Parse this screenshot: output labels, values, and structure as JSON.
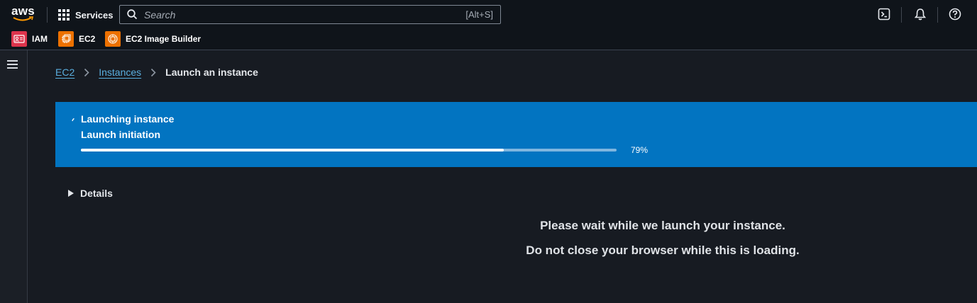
{
  "header": {
    "logo_text": "aws",
    "services_label": "Services",
    "search": {
      "placeholder": "Search",
      "shortcut": "[Alt+S]"
    },
    "tools": [
      "cloudshell-icon",
      "notifications-icon",
      "help-icon"
    ]
  },
  "favorites": [
    {
      "label": "IAM",
      "color": "#dd344c"
    },
    {
      "label": "EC2",
      "color": "#ed7100"
    },
    {
      "label": "EC2 Image Builder",
      "color": "#ed7100"
    }
  ],
  "breadcrumb": {
    "items": [
      "EC2",
      "Instances"
    ],
    "current": "Launch an instance"
  },
  "flash": {
    "title": "Launching instance",
    "subtitle": "Launch initiation",
    "progress_value": 0.79,
    "progress_label": "79%",
    "color": "#0274c1"
  },
  "details_label": "Details",
  "messages": {
    "line1": "Please wait while we launch your instance.",
    "line2": "Do not close your browser while this is loading."
  }
}
